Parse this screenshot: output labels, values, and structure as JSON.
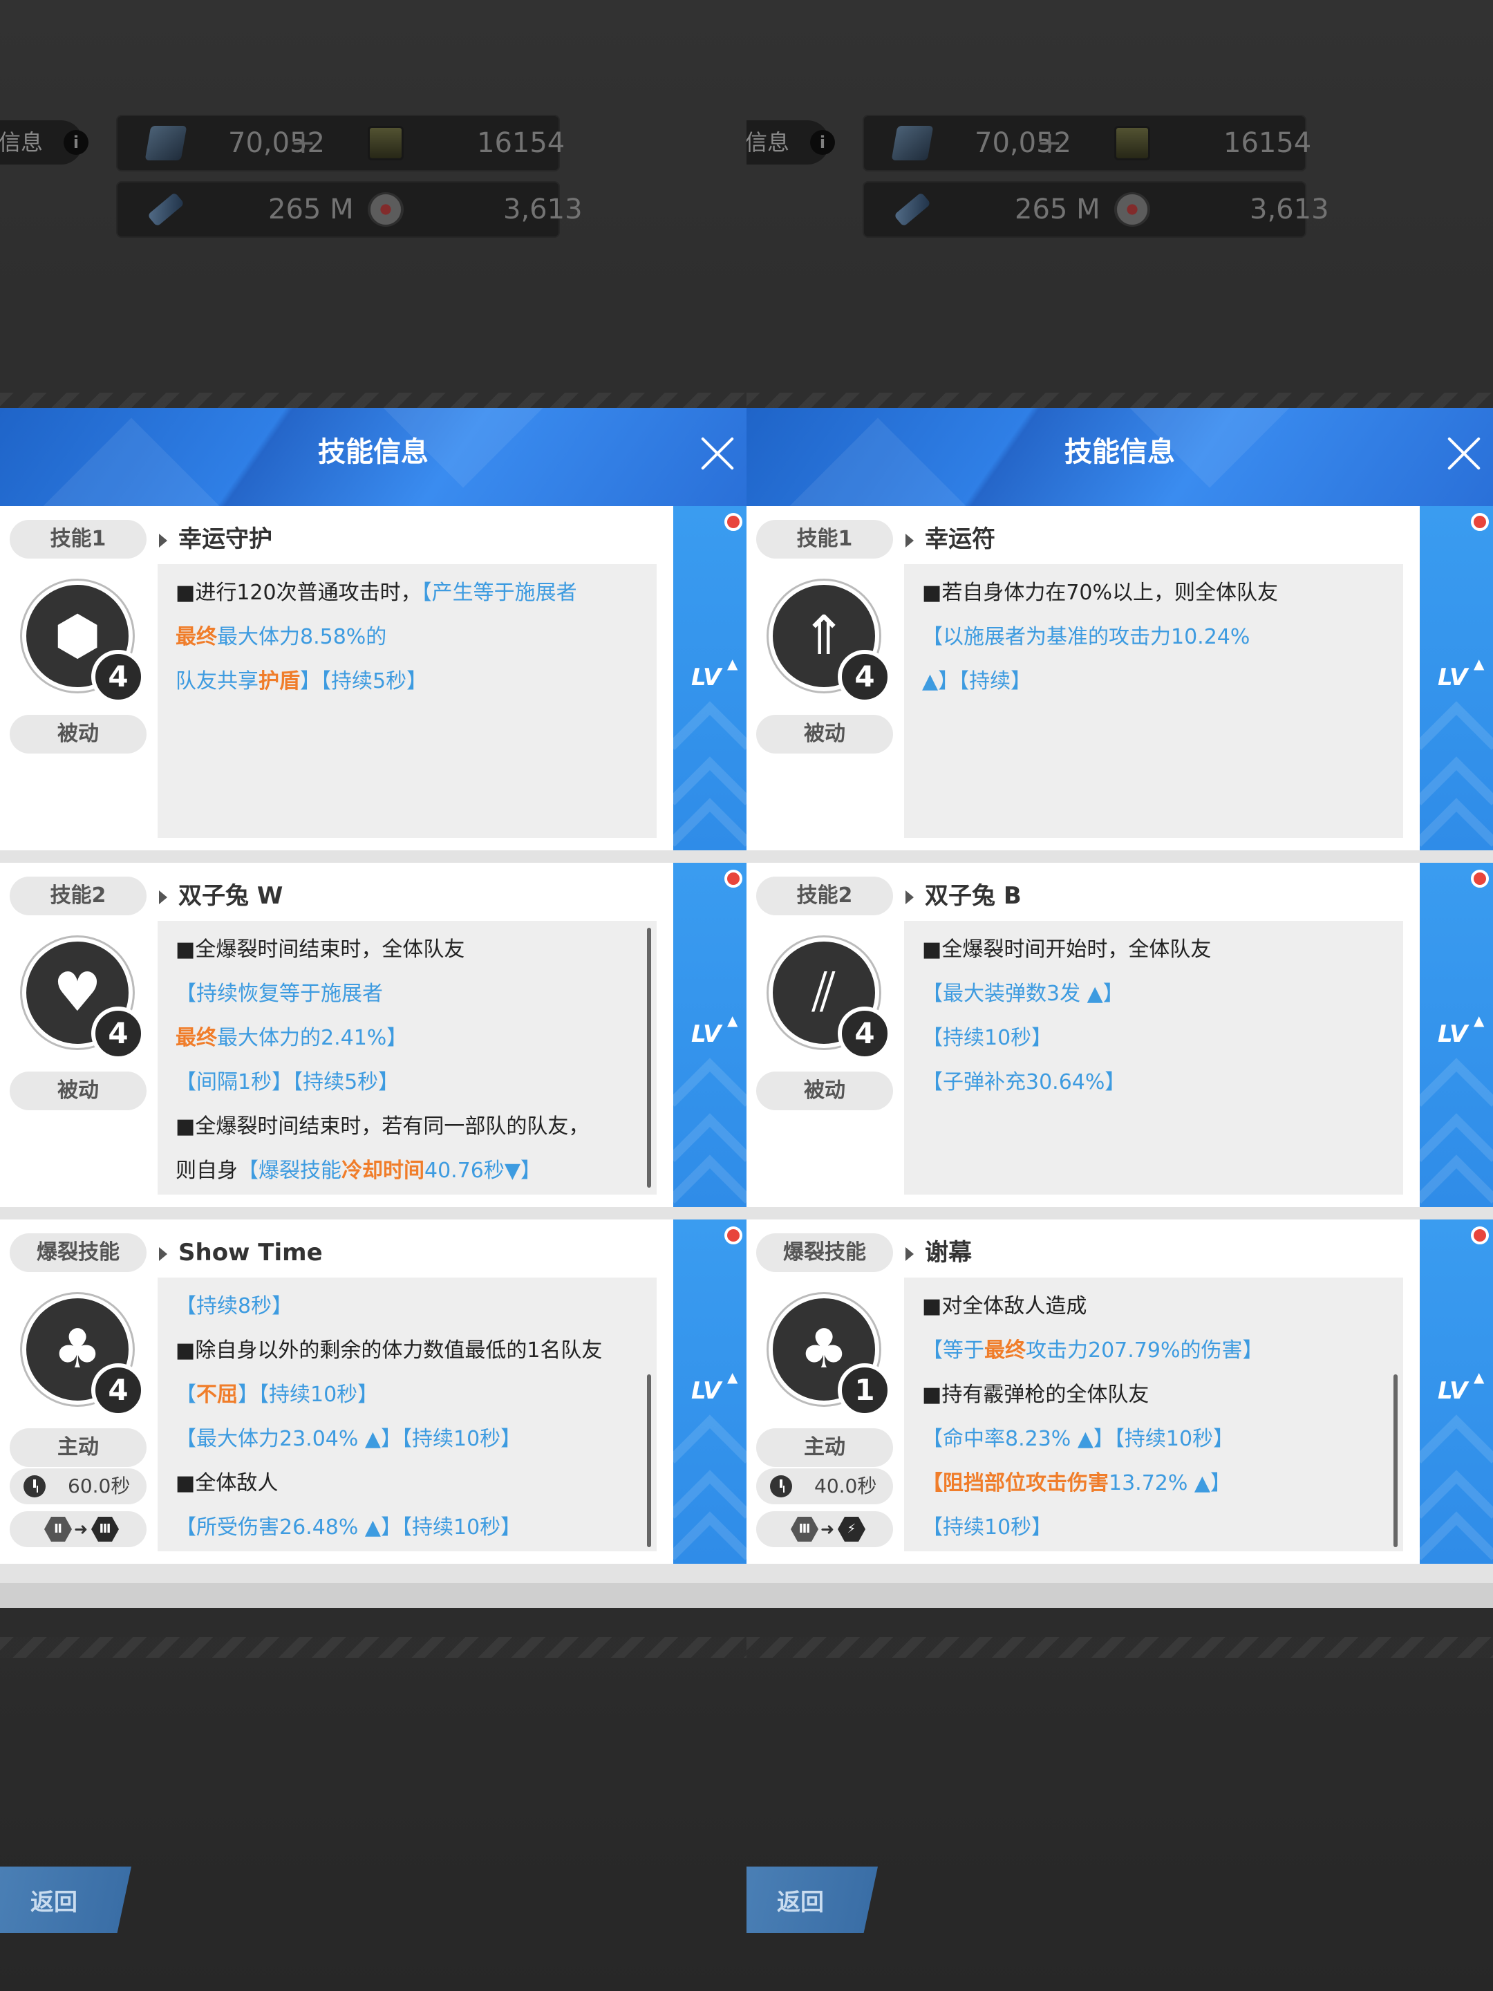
{
  "panels": [
    {
      "info_label": "信息",
      "resources": {
        "crystal": "70,052",
        "credits": "16154 K",
        "bullets": "265 M",
        "cores": "3,613"
      },
      "dialog_title": "技能信息",
      "back_label": "返回",
      "level_label": "LV",
      "skills": [
        {
          "slot": "技能1",
          "name": "幸运守护",
          "type": "被动",
          "level": "4",
          "icon": "hexagon-cluster-icon",
          "lines": [
            [
              {
                "t": "■进行120次普通攻击时，",
                "c": "k"
              },
              {
                "t": "【产生等于施展者",
                "c": "b"
              }
            ],
            [
              {
                "t": "最终",
                "c": "o"
              },
              {
                "t": "最大体力8.58%的",
                "c": "b"
              }
            ],
            [
              {
                "t": "队友共享",
                "c": "b"
              },
              {
                "t": "护盾",
                "c": "o"
              },
              {
                "t": "】【持续5秒】",
                "c": "b"
              }
            ]
          ]
        },
        {
          "slot": "技能2",
          "name": "双子兔 W",
          "type": "被动",
          "level": "4",
          "icon": "hearts-heal-icon",
          "lines": [
            [
              {
                "t": "■全爆裂时间结束时，全体队友",
                "c": "k"
              }
            ],
            [
              {
                "t": "【持续恢复等于施展者",
                "c": "b"
              }
            ],
            [
              {
                "t": "最终",
                "c": "o"
              },
              {
                "t": "最大体力的2.41%】",
                "c": "b"
              }
            ],
            [
              {
                "t": "【间隔1秒】【持续5秒】",
                "c": "b"
              }
            ],
            [
              {
                "t": "■全爆裂时间结束时，若有同一部队的队友，",
                "c": "k"
              }
            ],
            [
              {
                "t": "则自身",
                "c": "k"
              },
              {
                "t": "【爆裂技能",
                "c": "b"
              },
              {
                "t": "冷却时间",
                "c": "o"
              },
              {
                "t": "40.76秒▼】",
                "c": "b"
              }
            ]
          ]
        },
        {
          "slot": "爆裂技能",
          "name": "Show Time",
          "type": "主动",
          "level": "4",
          "icon": "rabbit-chip-icon",
          "cooldown": "60.0秒",
          "stage_from": "Ⅱ",
          "stage_to": "Ⅲ",
          "lines": [
            [
              {
                "t": "【持续8秒】",
                "c": "b"
              }
            ],
            [
              {
                "t": "■除自身以外的剩余的体力数值最低的1名队友",
                "c": "k"
              }
            ],
            [
              {
                "t": "【",
                "c": "b"
              },
              {
                "t": "不屈",
                "c": "o"
              },
              {
                "t": "】【持续10秒】",
                "c": "b"
              }
            ],
            [
              {
                "t": "【最大体力23.04% ▲】【持续10秒】",
                "c": "b"
              }
            ],
            [
              {
                "t": "■全体敌人",
                "c": "k"
              }
            ],
            [
              {
                "t": "【所受伤害26.48% ▲】【持续10秒】",
                "c": "b"
              }
            ]
          ]
        }
      ]
    },
    {
      "info_label": "信息",
      "resources": {
        "crystal": "70,052",
        "credits": "16154 K",
        "bullets": "265 M",
        "cores": "3,613"
      },
      "dialog_title": "技能信息",
      "back_label": "返回",
      "level_label": "LV",
      "skills": [
        {
          "slot": "技能1",
          "name": "幸运符",
          "type": "被动",
          "level": "4",
          "icon": "attack-up-icon",
          "lines": [
            [
              {
                "t": "■若自身体力在70%以上，则全体队友",
                "c": "k"
              }
            ],
            [
              {
                "t": "【以施展者为基准的攻击力10.24%",
                "c": "b"
              }
            ],
            [
              {
                "t": "▲】【持续】",
                "c": "b"
              }
            ]
          ]
        },
        {
          "slot": "技能2",
          "name": "双子兔 B",
          "type": "被动",
          "level": "4",
          "icon": "ammo-magazine-icon",
          "lines": [
            [
              {
                "t": "■全爆裂时间开始时，全体队友",
                "c": "k"
              }
            ],
            [
              {
                "t": "【最大装弹数3发 ▲】",
                "c": "b"
              }
            ],
            [
              {
                "t": "【持续10秒】",
                "c": "b"
              }
            ],
            [
              {
                "t": "【子弹补充30.64%】",
                "c": "b"
              }
            ]
          ]
        },
        {
          "slot": "爆裂技能",
          "name": "谢幕",
          "type": "主动",
          "level": "1",
          "icon": "rabbit-chip-icon",
          "cooldown": "40.0秒",
          "stage_from": "Ⅲ",
          "stage_to": "⚡",
          "lines": [
            [
              {
                "t": "■对全体敌人造成",
                "c": "k"
              }
            ],
            [
              {
                "t": "【等于",
                "c": "b"
              },
              {
                "t": "最终",
                "c": "o"
              },
              {
                "t": "攻击力207.79%的伤害】",
                "c": "b"
              }
            ],
            [
              {
                "t": "■持有霰弹枪的全体队友",
                "c": "k"
              }
            ],
            [
              {
                "t": "【命中率8.23% ▲】【持续10秒】",
                "c": "b"
              }
            ],
            [
              {
                "t": "【",
                "c": "o"
              },
              {
                "t": "阻挡部位攻击伤害",
                "c": "o"
              },
              {
                "t": "13.72% ▲】",
                "c": "b"
              }
            ],
            [
              {
                "t": "【持续10秒】",
                "c": "b"
              }
            ]
          ]
        }
      ]
    }
  ]
}
